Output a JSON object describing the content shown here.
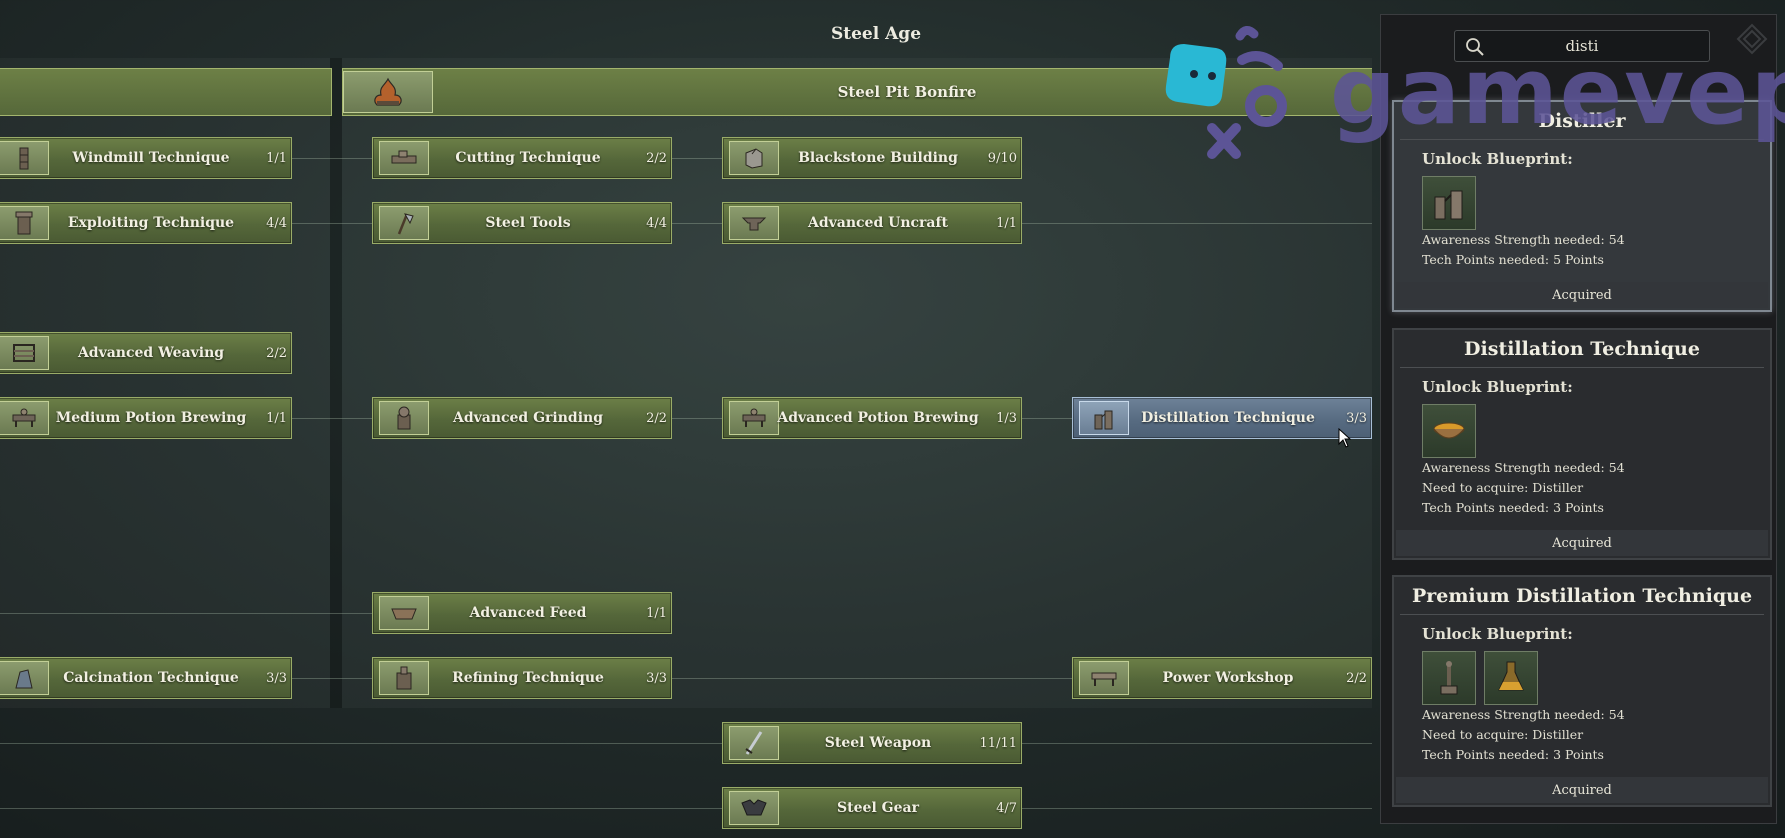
{
  "age_title": "Steel Age",
  "header_node": {
    "label": "Steel Pit Bonfire"
  },
  "nodes": [
    {
      "label": "Windmill Technique",
      "count": "1/1",
      "icon": "windmill-icon"
    },
    {
      "label": "Cutting Technique",
      "count": "2/2",
      "icon": "saw-icon"
    },
    {
      "label": "Blackstone Building",
      "count": "9/10",
      "icon": "stone-block-icon"
    },
    {
      "label": "Exploiting Technique",
      "count": "4/4",
      "icon": "tower-icon"
    },
    {
      "label": "Steel Tools",
      "count": "4/4",
      "icon": "axe-icon"
    },
    {
      "label": "Advanced Uncraft",
      "count": "1/1",
      "icon": "anvil-icon"
    },
    {
      "label": "Advanced Weaving",
      "count": "2/2",
      "icon": "loom-icon"
    },
    {
      "label": "Medium Potion Brewing",
      "count": "1/1",
      "icon": "brewing-station-icon"
    },
    {
      "label": "Advanced Grinding",
      "count": "2/2",
      "icon": "grinder-icon"
    },
    {
      "label": "Advanced Potion Brewing",
      "count": "1/3",
      "icon": "brewing-station-icon"
    },
    {
      "label": "Distillation Technique",
      "count": "3/3",
      "icon": "distiller-icon"
    },
    {
      "label": "Advanced Feed",
      "count": "1/1",
      "icon": "trough-icon"
    },
    {
      "label": "Calcination Technique",
      "count": "3/3",
      "icon": "kiln-icon"
    },
    {
      "label": "Refining Technique",
      "count": "3/3",
      "icon": "refinery-icon"
    },
    {
      "label": "Power Workshop",
      "count": "2/2",
      "icon": "workbench-icon"
    },
    {
      "label": "Steel Weapon",
      "count": "11/11",
      "icon": "sword-icon"
    },
    {
      "label": "Steel Gear",
      "count": "4/7",
      "icon": "armor-icon"
    }
  ],
  "search": {
    "value": "disti"
  },
  "watermark": "gamevep",
  "cards": [
    {
      "title": "Distiller",
      "subtitle": "Unlock Blueprint:",
      "thumbs": [
        "distiller-icon"
      ],
      "info": [
        "Awareness Strength needed: 54",
        "Tech Points needed: 5 Points"
      ],
      "status": "Acquired"
    },
    {
      "title": "Distillation Technique",
      "subtitle": "Unlock Blueprint:",
      "thumbs": [
        "bowl-icon"
      ],
      "info": [
        "Awareness Strength needed: 54",
        "Need to acquire: Distiller",
        "Tech Points needed: 3 Points"
      ],
      "status": "Acquired"
    },
    {
      "title": "Premium Distillation Technique",
      "subtitle": "Unlock Blueprint:",
      "thumbs": [
        "still-stand-icon",
        "flask-icon"
      ],
      "info": [
        "Awareness Strength needed: 54",
        "Need to acquire: Distiller",
        "Tech Points needed: 3 Points"
      ],
      "status": "Acquired"
    }
  ],
  "colors": {
    "node_green": "#5c6e3e",
    "node_selected_blue": "#5d7188",
    "panel_bg": "#1b1c1e",
    "watermark_blue": "#2ab9d6",
    "watermark_purple": "#5c5496"
  }
}
